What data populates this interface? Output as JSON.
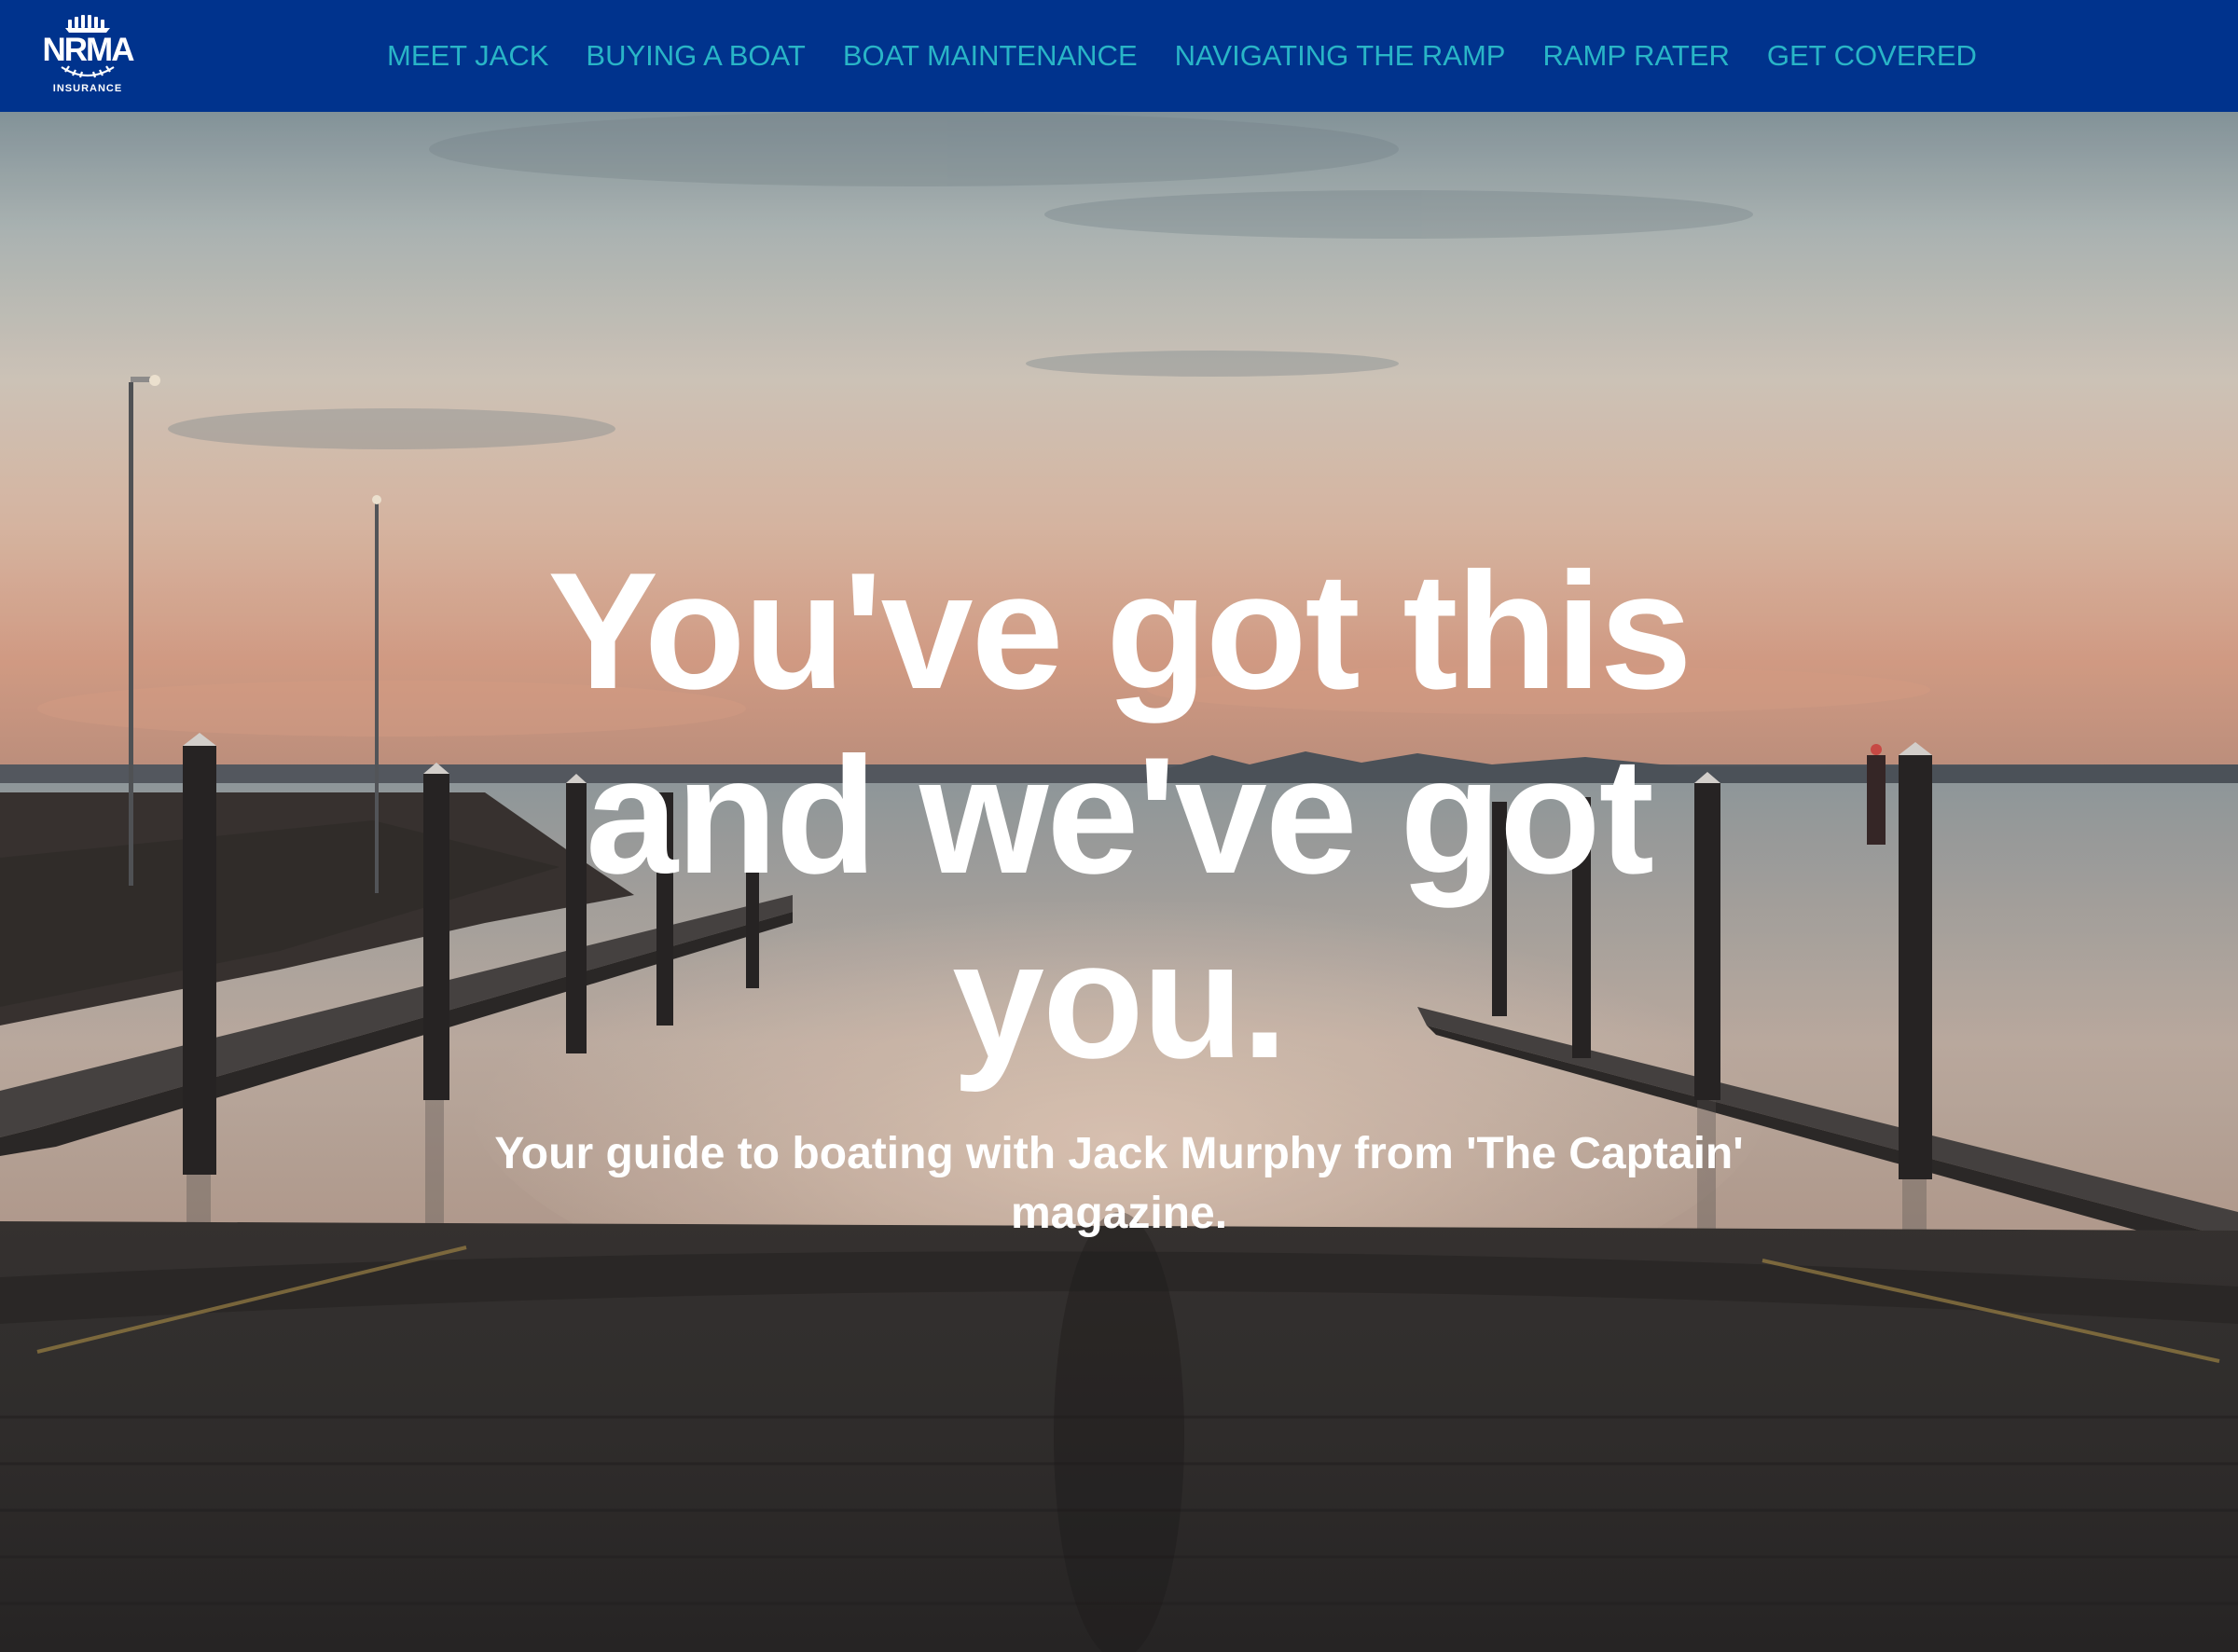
{
  "brand": {
    "logo_text": "NRMA",
    "logo_subtext": "INSURANCE",
    "header_color": "#00338d",
    "nav_color": "#29b5c7"
  },
  "nav": {
    "items": [
      {
        "label": "MEET JACK"
      },
      {
        "label": "BUYING A BOAT"
      },
      {
        "label": "BOAT MAINTENANCE"
      },
      {
        "label": "NAVIGATING THE RAMP"
      },
      {
        "label": "RAMP RATER"
      },
      {
        "label": "GET COVERED"
      }
    ]
  },
  "hero": {
    "headline": "You've got this and we've got you.",
    "subheadline": "Your guide to boating with Jack Murphy from 'The Captain' magazine."
  }
}
